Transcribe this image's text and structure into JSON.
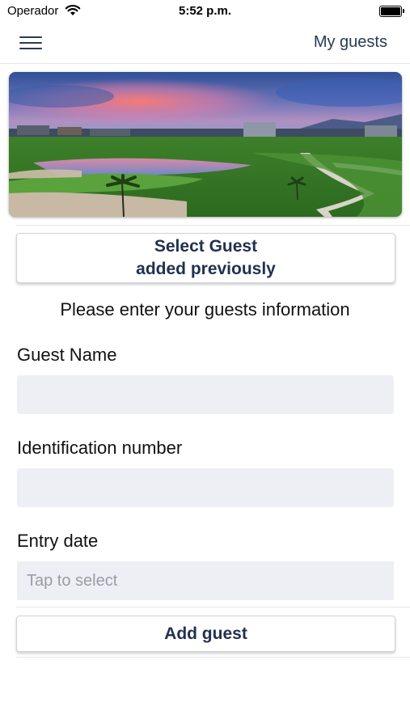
{
  "status_bar": {
    "carrier": "Operador",
    "time": "5:52 p.m."
  },
  "header": {
    "title": "My guests",
    "menu_icon": "hamburger-menu-icon"
  },
  "hero": {
    "image_description_icon": "golf-course-photo"
  },
  "select_guest": {
    "line1": "Select Guest",
    "line2": "added previously"
  },
  "form": {
    "instructions": "Please enter your guests information",
    "guest_name": {
      "label": "Guest Name",
      "value": "",
      "placeholder": ""
    },
    "identification": {
      "label": "Identification number",
      "value": "",
      "placeholder": ""
    },
    "entry_date": {
      "label": "Entry date",
      "value": "",
      "placeholder": "Tap to select"
    },
    "submit_label": "Add guest"
  },
  "colors": {
    "accent": "#22314f",
    "input_bg": "#eeeff4"
  }
}
